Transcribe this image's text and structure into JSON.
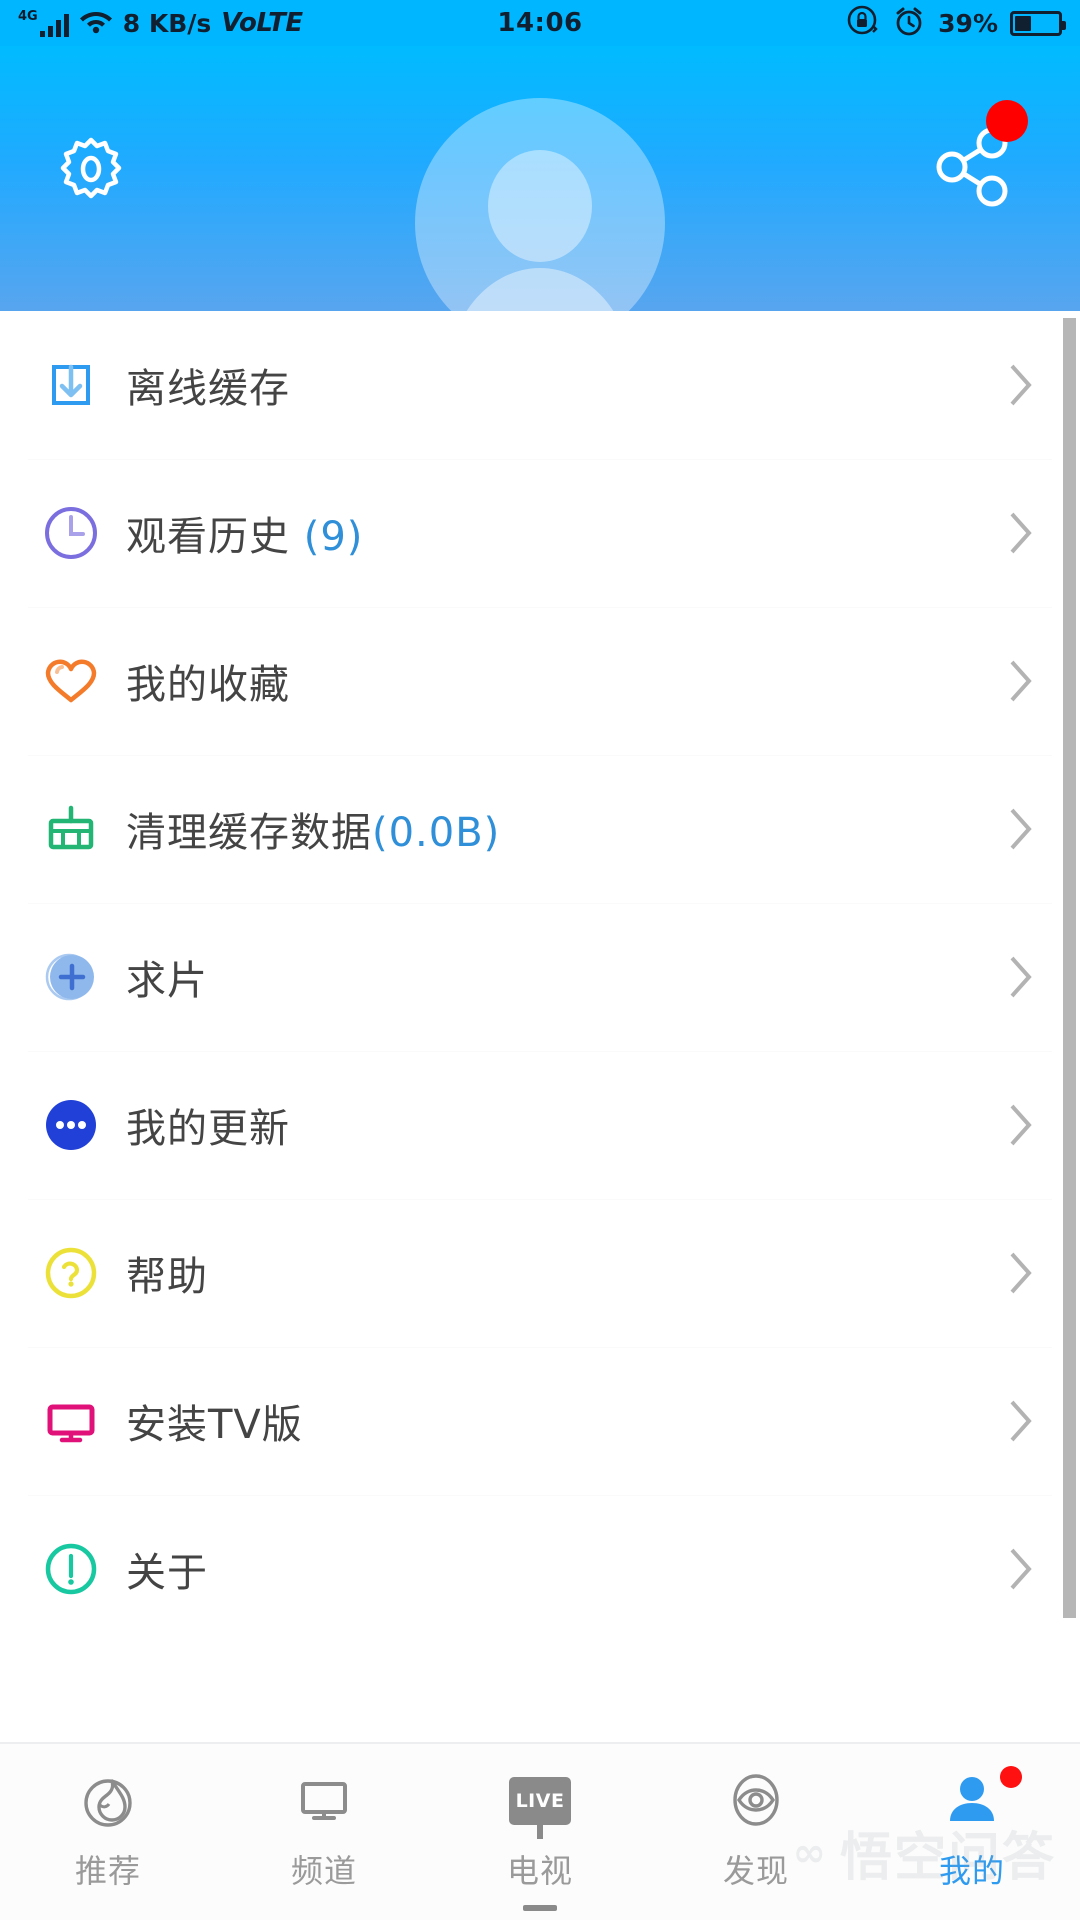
{
  "status_bar": {
    "network_type": "4G",
    "data_rate": "8 KB/s",
    "volte_label": "VoLTE",
    "time": "14:06",
    "battery_percent": "39%",
    "icons": [
      "signal-bars-icon",
      "wifi-icon",
      "rotation-lock-icon",
      "alarm-clock-icon",
      "battery-icon"
    ]
  },
  "header": {
    "settings_icon": "gear-icon",
    "share_icon": "share-icon",
    "avatar_icon": "avatar-placeholder",
    "share_badge": "red-dot-badge",
    "gradient_top": "#00bbff",
    "gradient_bottom": "#58a5ef"
  },
  "menu": {
    "items": [
      {
        "label": "离线缓存",
        "suffix": "",
        "icon": "download-box-icon",
        "color": "#2f9bf0"
      },
      {
        "label": "观看历史 ",
        "suffix": "(9)",
        "icon": "clock-icon",
        "color": "#7b6fe0"
      },
      {
        "label": "我的收藏",
        "suffix": "",
        "icon": "heart-icon",
        "color": "#f47b2a"
      },
      {
        "label": "清理缓存数据",
        "suffix": "(0.0B)",
        "icon": "broom-icon",
        "color": "#22b573"
      },
      {
        "label": "求片",
        "suffix": "",
        "icon": "plus-circle-icon",
        "color": "#7ba9e8"
      },
      {
        "label": " 我的更新",
        "suffix": "",
        "icon": "more-dots-icon",
        "color": "#2040d8"
      },
      {
        "label": "帮助",
        "suffix": "",
        "icon": "question-circle-icon",
        "color": "#ece139"
      },
      {
        "label": "安装TV版",
        "suffix": "",
        "icon": "tv-icon",
        "color": "#e0127a"
      },
      {
        "label": "关于",
        "suffix": "",
        "icon": "info-circle-icon",
        "color": "#17c8a0"
      }
    ],
    "chevron_icon": "chevron-right-icon"
  },
  "bottom_nav": {
    "items": [
      {
        "label": "推荐",
        "icon": "flame-icon",
        "active": false,
        "badge": false
      },
      {
        "label": "频道",
        "icon": "monitor-icon",
        "active": false,
        "badge": false
      },
      {
        "label": "电视",
        "icon": "live-tv-icon",
        "active": false,
        "badge": false,
        "live_text": "LIVE"
      },
      {
        "label": "发现",
        "icon": "eye-icon",
        "active": false,
        "badge": false
      },
      {
        "label": "我的",
        "icon": "person-icon",
        "active": true,
        "badge": true
      }
    ],
    "active_color": "#2f9bf0",
    "inactive_color": "#9a9a9a"
  },
  "watermark": {
    "text": "悟空问答",
    "cloud": "∞"
  }
}
